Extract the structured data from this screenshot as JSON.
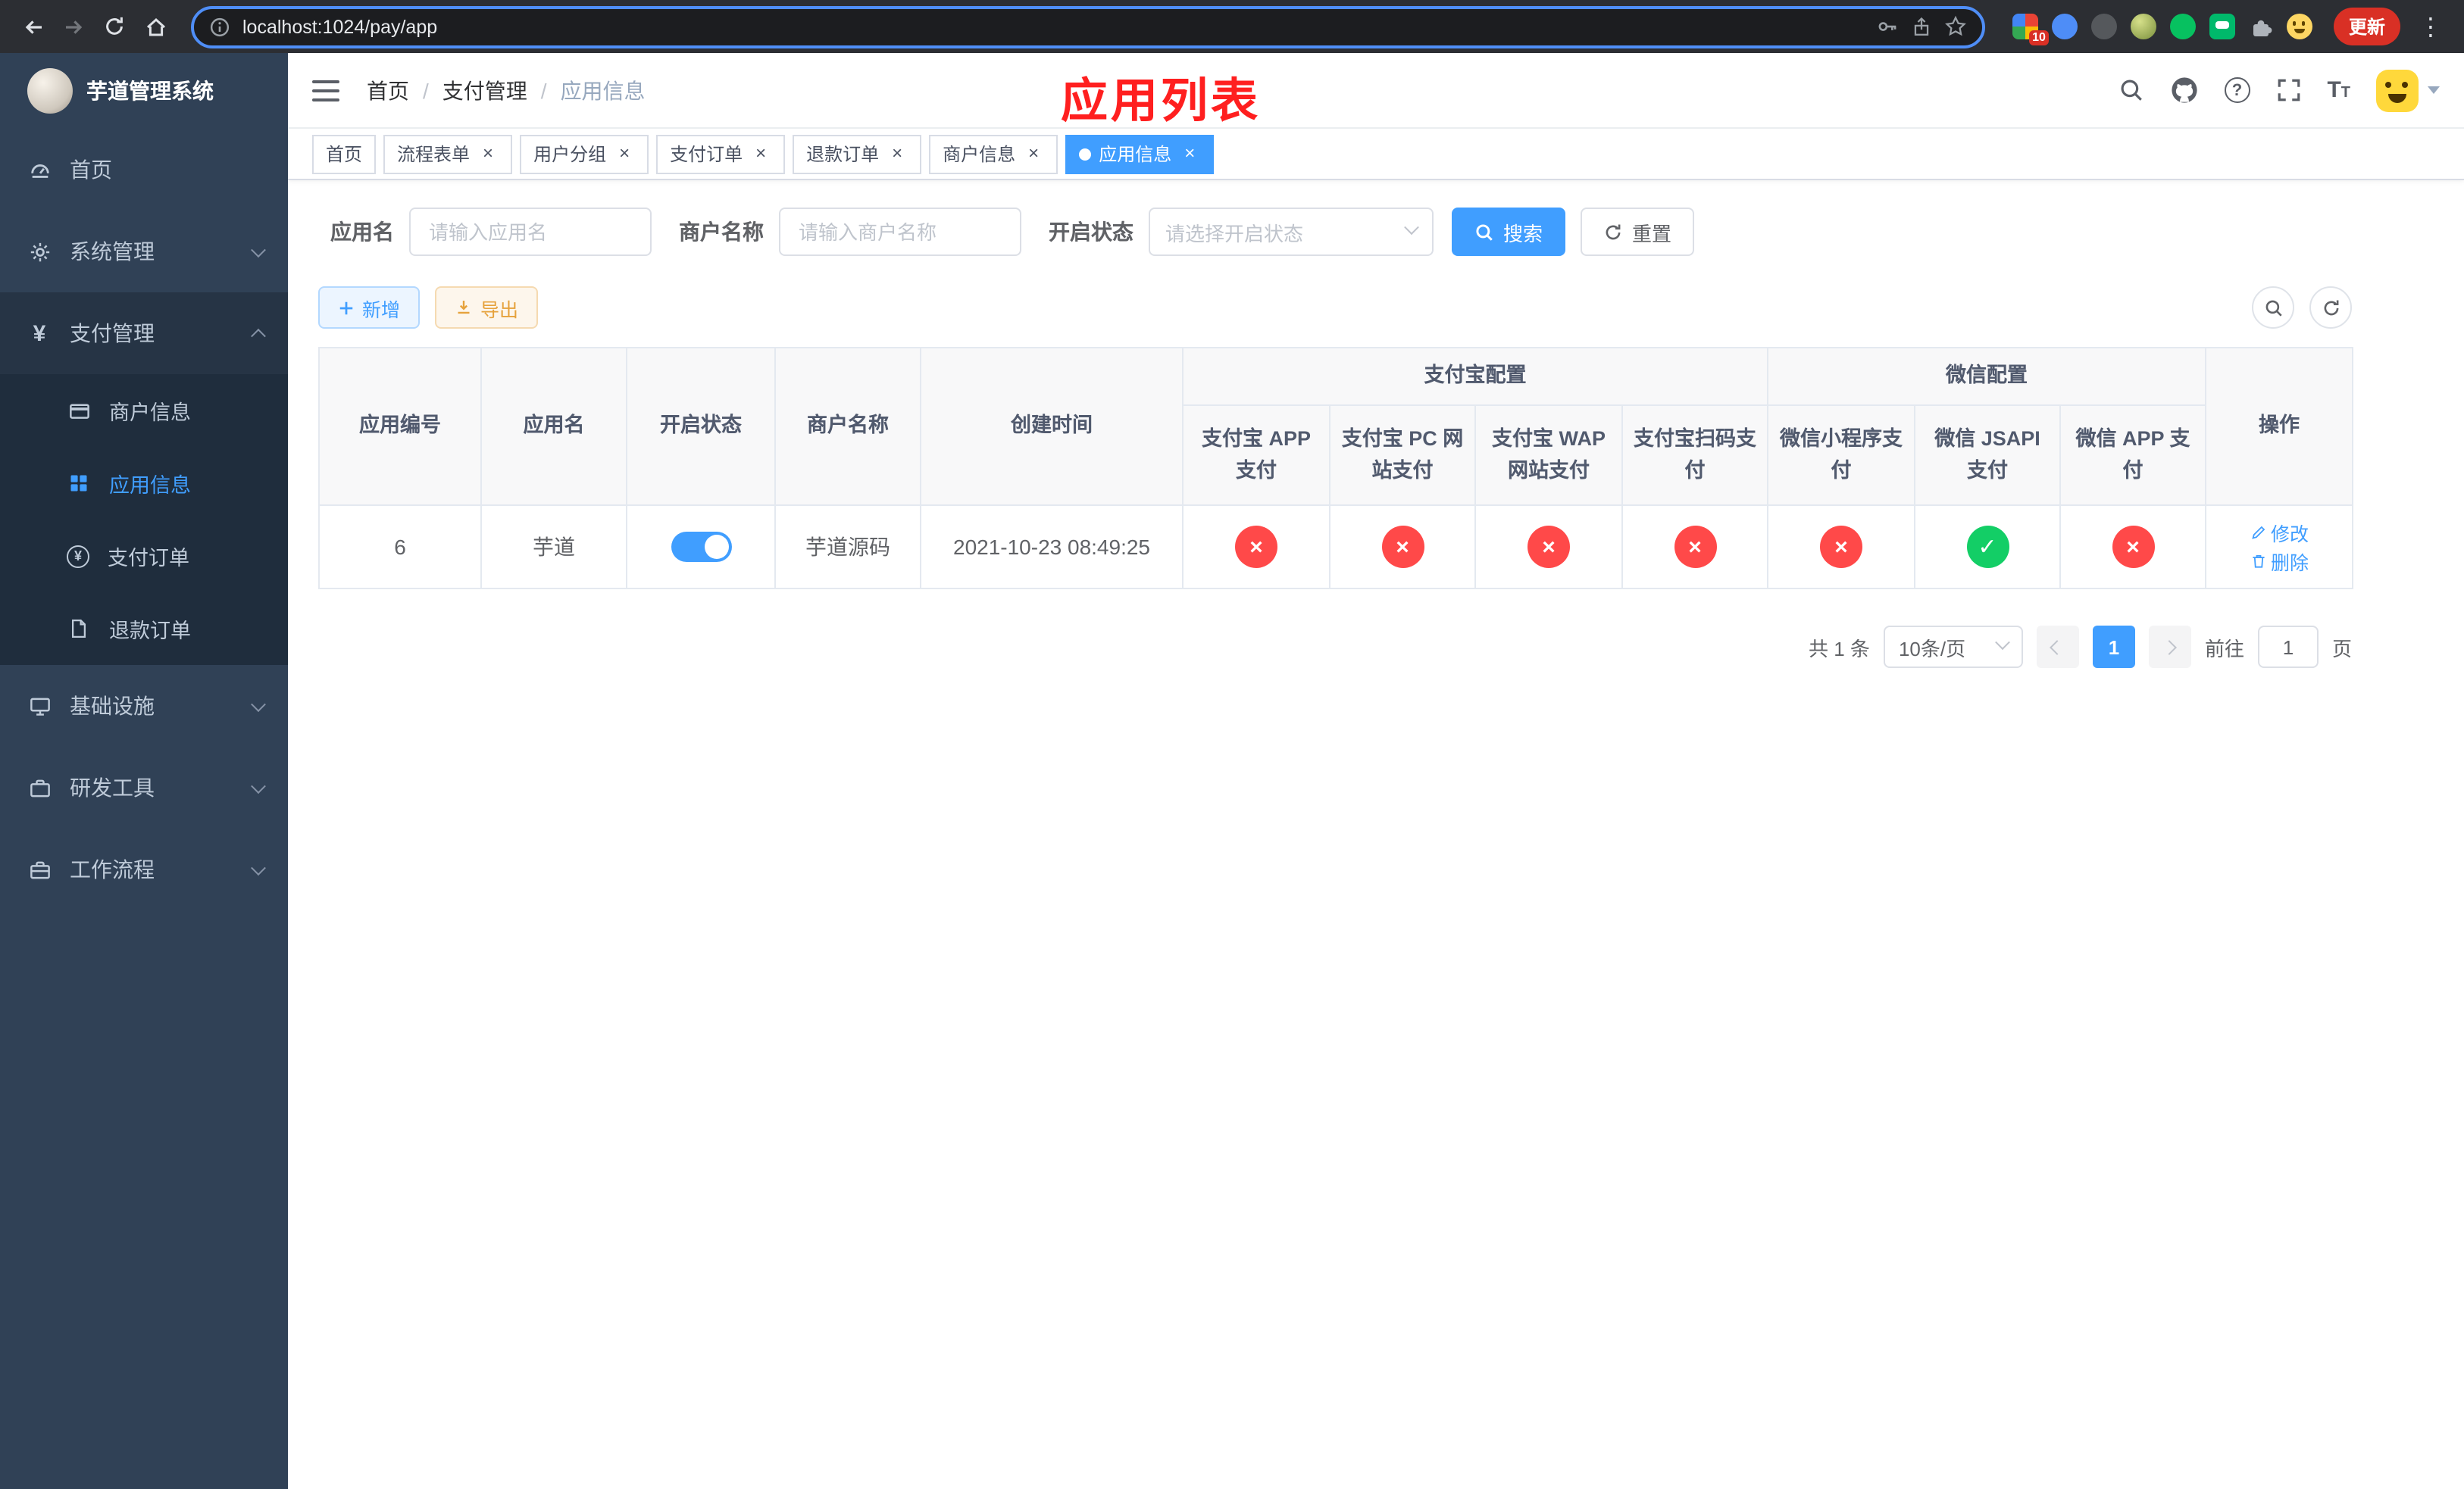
{
  "colors": {
    "primary": "#409eff",
    "success": "#13ce66",
    "danger": "#ff4949",
    "sidebar_bg": "#304156",
    "annotation_red": "#ff1f1f"
  },
  "browser": {
    "url": "localhost:1024/pay/app",
    "update_label": "更新",
    "extension_badge": "10"
  },
  "annotation": "应用列表",
  "sidebar": {
    "title": "芋道管理系统",
    "home": "首页",
    "system": "系统管理",
    "payment": "支付管理",
    "merchant_info": "商户信息",
    "app_info": "应用信息",
    "pay_order": "支付订单",
    "refund_order": "退款订单",
    "infra": "基础设施",
    "dev_tools": "研发工具",
    "workflow": "工作流程"
  },
  "breadcrumb": {
    "home": "首页",
    "payment": "支付管理",
    "current": "应用信息",
    "separator": "/"
  },
  "tabs": {
    "home": "首页",
    "flow_form": "流程表单",
    "user_group": "用户分组",
    "pay_order": "支付订单",
    "refund_order": "退款订单",
    "merchant_info": "商户信息",
    "app_info": "应用信息"
  },
  "icons": {
    "close": "×",
    "cross": "×",
    "check": "✓",
    "menu_dots": "⋮",
    "yen": "¥",
    "question": "?",
    "font_large": "T",
    "font_small": "T"
  },
  "filters": {
    "name_label": "应用名",
    "name_placeholder": "请输入应用名",
    "merchant_label": "商户名称",
    "merchant_placeholder": "请输入商户名称",
    "status_label": "开启状态",
    "status_placeholder": "请选择开启状态",
    "search": "搜索",
    "reset": "重置"
  },
  "toolbar": {
    "add": "新增",
    "export": "导出"
  },
  "table": {
    "col_id": "应用编号",
    "col_name": "应用名",
    "col_status": "开启状态",
    "col_merchant": "商户名称",
    "col_created": "创建时间",
    "group_alipay": "支付宝配置",
    "group_wechat": "微信配置",
    "col_alipay_app": "支付宝 APP 支付",
    "col_alipay_pc": "支付宝 PC 网站支付",
    "col_alipay_wap": "支付宝 WAP 网站支付",
    "col_alipay_qr": "支付宝扫码支付",
    "col_wx_mini": "微信小程序支付",
    "col_wx_jsapi": "微信 JSAPI 支付",
    "col_wx_app": "微信 APP 支付",
    "col_ops": "操作",
    "row": {
      "id": "6",
      "name": "芋道",
      "enabled": true,
      "merchant": "芋道源码",
      "created": "2021-10-23 08:49:25",
      "alipay_app": false,
      "alipay_pc": false,
      "alipay_wap": false,
      "alipay_qr": false,
      "wx_mini": false,
      "wx_jsapi": true,
      "wx_app": false,
      "edit": "修改",
      "delete": "删除"
    }
  },
  "pagination": {
    "total": "共 1 条",
    "page_size": "10条/页",
    "page": "1",
    "goto": "前往",
    "goto_value": "1",
    "unit": "页"
  }
}
